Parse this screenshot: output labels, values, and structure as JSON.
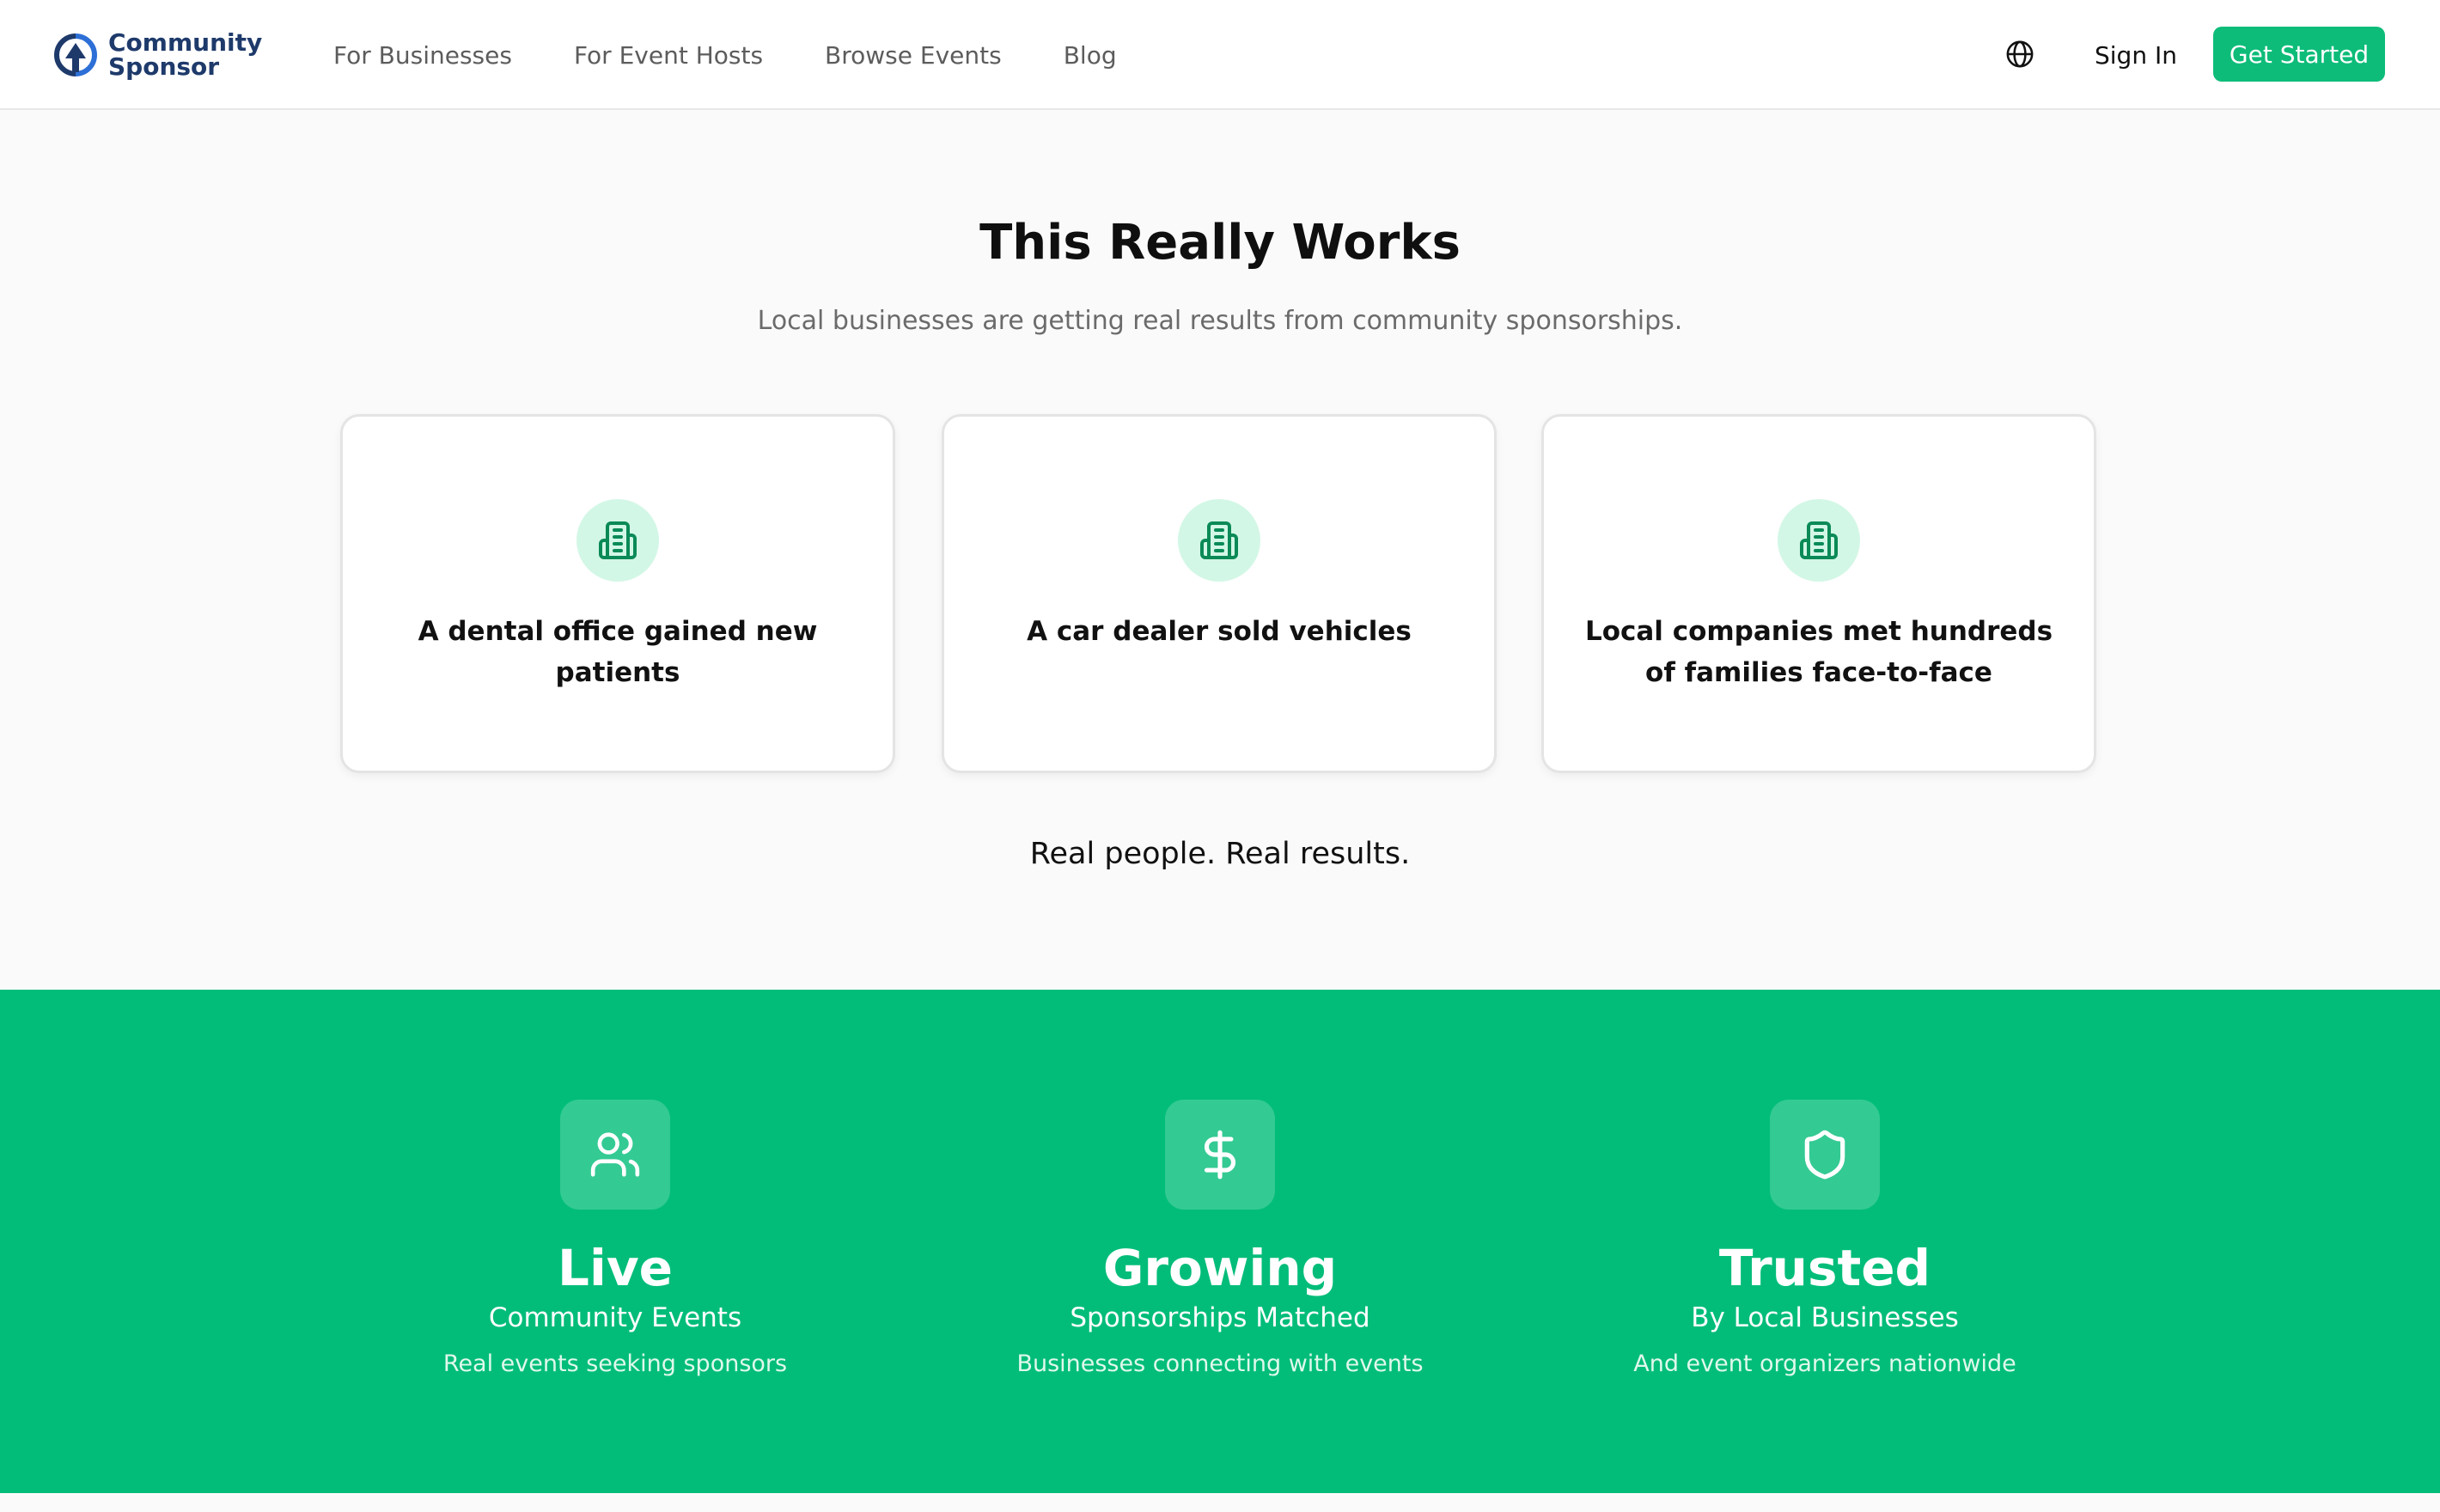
{
  "header": {
    "logo": {
      "line1": "Community",
      "line2": "Sponsor"
    },
    "nav": [
      "For Businesses",
      "For Event Hosts",
      "Browse Events",
      "Blog"
    ],
    "language_icon": "globe-icon",
    "sign_in": "Sign In",
    "get_started": "Get Started"
  },
  "results": {
    "title": "This Really Works",
    "subtitle": "Local businesses are getting real results from community sponsorships.",
    "cards": [
      {
        "icon": "building-icon",
        "text": "A dental office gained new patients"
      },
      {
        "icon": "building-icon",
        "text": "A car dealer sold vehicles"
      },
      {
        "icon": "building-icon",
        "text": "Local companies met hundreds of families face-to-face"
      }
    ],
    "tagline": "Real people. Real results."
  },
  "stats": [
    {
      "icon": "users-icon",
      "title": "Live",
      "subtitle": "Community Events",
      "description": "Real events seeking sponsors"
    },
    {
      "icon": "dollar-icon",
      "title": "Growing",
      "subtitle": "Sponsorships Matched",
      "description": "Businesses connecting with events"
    },
    {
      "icon": "shield-icon",
      "title": "Trusted",
      "subtitle": "By Local Businesses",
      "description": "And event organizers nationwide"
    }
  ],
  "colors": {
    "brand_green": "#02bd7a",
    "button_green": "#0dbc79",
    "logo_navy": "#1e3a6b",
    "icon_bg": "#d3f7e6",
    "icon_stroke": "#0a8a57"
  }
}
